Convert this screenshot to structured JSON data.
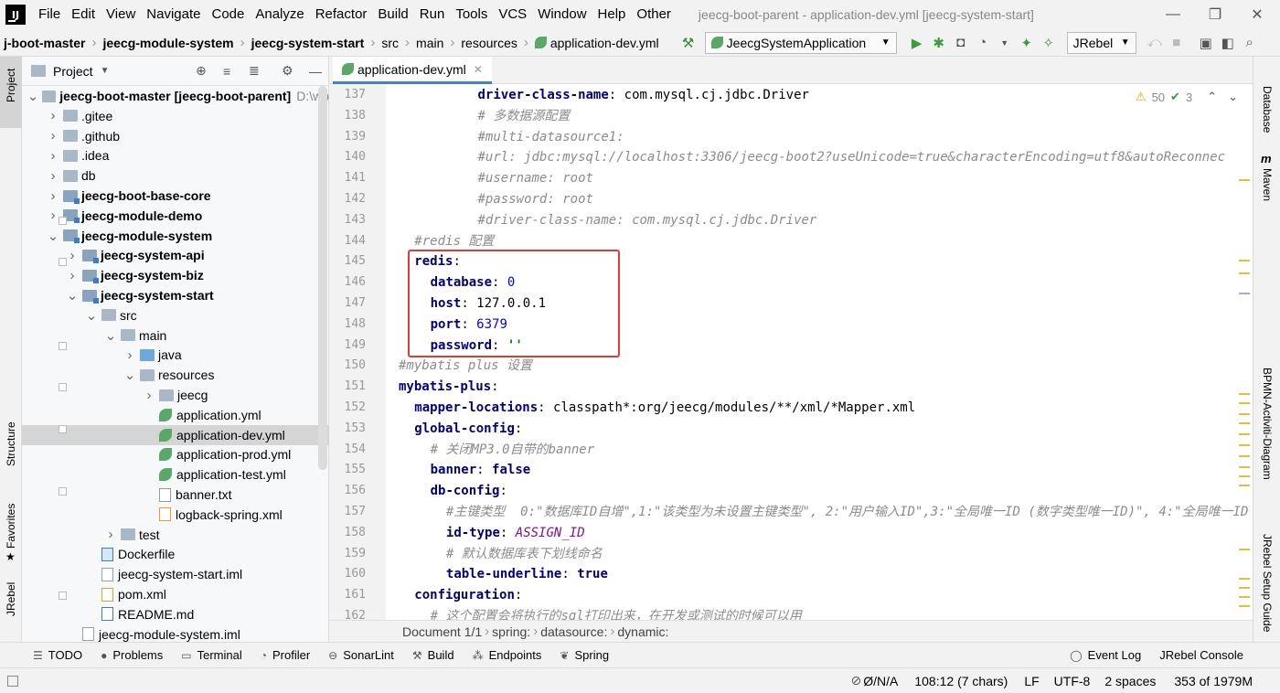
{
  "menu": [
    "File",
    "Edit",
    "View",
    "Navigate",
    "Code",
    "Analyze",
    "Refactor",
    "Build",
    "Run",
    "Tools",
    "VCS",
    "Window",
    "Help",
    "Other"
  ],
  "window_title": "jeecg-boot-parent - application-dev.yml [jeecg-system-start]",
  "nav": {
    "crumbs": [
      "j-boot-master",
      "jeecg-module-system",
      "jeecg-system-start",
      "src",
      "main",
      "resources",
      "application-dev.yml"
    ],
    "run_config": "JeecgSystemApplication",
    "jrebel": "JRebel"
  },
  "strip_left": {
    "project": "Project",
    "structure": "Structure",
    "favorites": "Favorites",
    "jrebel": "JRebel"
  },
  "project": {
    "title": "Project",
    "tree": [
      {
        "label": "jeecg-boot-master",
        "suffix": "[jeecg-boot-parent]",
        "path": "D:\\wo",
        "depth": 0,
        "arrow": "down",
        "icon": "folder",
        "bold": true
      },
      {
        "label": ".gitee",
        "depth": 1,
        "arrow": "right",
        "icon": "folder"
      },
      {
        "label": ".github",
        "depth": 1,
        "arrow": "right",
        "icon": "folder"
      },
      {
        "label": ".idea",
        "depth": 1,
        "arrow": "right",
        "icon": "folder"
      },
      {
        "label": "db",
        "depth": 1,
        "arrow": "right",
        "icon": "folder"
      },
      {
        "label": "jeecg-boot-base-core",
        "depth": 1,
        "arrow": "right",
        "icon": "module",
        "bold": true
      },
      {
        "label": "jeecg-module-demo",
        "depth": 1,
        "arrow": "right",
        "icon": "module",
        "bold": true
      },
      {
        "label": "jeecg-module-system",
        "depth": 1,
        "arrow": "down",
        "icon": "module",
        "bold": true
      },
      {
        "label": "jeecg-system-api",
        "depth": 2,
        "arrow": "right",
        "icon": "module",
        "bold": true
      },
      {
        "label": "jeecg-system-biz",
        "depth": 2,
        "arrow": "right",
        "icon": "module",
        "bold": true
      },
      {
        "label": "jeecg-system-start",
        "depth": 2,
        "arrow": "down",
        "icon": "module",
        "bold": true
      },
      {
        "label": "src",
        "depth": 3,
        "arrow": "down",
        "icon": "folder"
      },
      {
        "label": "main",
        "depth": 4,
        "arrow": "down",
        "icon": "folder"
      },
      {
        "label": "java",
        "depth": 5,
        "arrow": "right",
        "icon": "src"
      },
      {
        "label": "resources",
        "depth": 5,
        "arrow": "down",
        "icon": "res"
      },
      {
        "label": "jeecg",
        "depth": 6,
        "arrow": "right",
        "icon": "folder"
      },
      {
        "label": "application.yml",
        "depth": 6,
        "icon": "yml"
      },
      {
        "label": "application-dev.yml",
        "depth": 6,
        "icon": "yml",
        "selected": true
      },
      {
        "label": "application-prod.yml",
        "depth": 6,
        "icon": "yml"
      },
      {
        "label": "application-test.yml",
        "depth": 6,
        "icon": "yml"
      },
      {
        "label": "banner.txt",
        "depth": 6,
        "icon": "txt"
      },
      {
        "label": "logback-spring.xml",
        "depth": 6,
        "icon": "xml"
      },
      {
        "label": "test",
        "depth": 4,
        "arrow": "right",
        "icon": "folder"
      },
      {
        "label": "Dockerfile",
        "depth": 3,
        "icon": "docker"
      },
      {
        "label": "jeecg-system-start.iml",
        "depth": 3,
        "icon": "iml"
      },
      {
        "label": "pom.xml",
        "depth": 3,
        "icon": "xml"
      },
      {
        "label": "README.md",
        "depth": 3,
        "icon": "md"
      },
      {
        "label": "jeecg-module-system.iml",
        "depth": 2,
        "icon": "iml"
      }
    ]
  },
  "editor": {
    "tab": "application-dev.yml",
    "warnings": "50",
    "checks": "3",
    "lines": [
      {
        "n": "137",
        "i": 5,
        "parts": [
          [
            "k",
            "driver-class-name"
          ],
          [
            "v",
            ": com.mysql.cj.jdbc.Driver"
          ]
        ]
      },
      {
        "n": "138",
        "i": 5,
        "parts": [
          [
            "c",
            "# 多数据源配置"
          ]
        ]
      },
      {
        "n": "139",
        "i": 5,
        "parts": [
          [
            "c",
            "#multi-datasource1:"
          ]
        ]
      },
      {
        "n": "140",
        "i": 5,
        "parts": [
          [
            "c",
            "#url: jdbc:mysql://localhost:3306/jeecg-boot2?useUnicode=true&characterEncoding=utf8&autoReconnec"
          ]
        ]
      },
      {
        "n": "141",
        "i": 5,
        "parts": [
          [
            "c",
            "#username: root"
          ]
        ]
      },
      {
        "n": "142",
        "i": 5,
        "parts": [
          [
            "c",
            "#password: root"
          ]
        ]
      },
      {
        "n": "143",
        "i": 5,
        "parts": [
          [
            "c",
            "#driver-class-name: com.mysql.cj.jdbc.Driver"
          ]
        ]
      },
      {
        "n": "144",
        "i": 1,
        "parts": [
          [
            "c",
            "#redis 配置"
          ]
        ]
      },
      {
        "n": "145",
        "i": 1,
        "parts": [
          [
            "k",
            "redis"
          ],
          [
            "v",
            ":"
          ]
        ]
      },
      {
        "n": "146",
        "i": 2,
        "parts": [
          [
            "k",
            "database"
          ],
          [
            "v",
            ": "
          ],
          [
            "n",
            "0"
          ]
        ]
      },
      {
        "n": "147",
        "i": 2,
        "parts": [
          [
            "k",
            "host"
          ],
          [
            "v",
            ": 127.0.0.1"
          ]
        ]
      },
      {
        "n": "148",
        "i": 2,
        "parts": [
          [
            "k",
            "port"
          ],
          [
            "v",
            ": "
          ],
          [
            "n",
            "6379"
          ]
        ]
      },
      {
        "n": "149",
        "i": 2,
        "parts": [
          [
            "k",
            "password"
          ],
          [
            "v",
            ": "
          ],
          [
            "s",
            "''"
          ]
        ]
      },
      {
        "n": "150",
        "i": 0,
        "parts": [
          [
            "c",
            "#mybatis plus 设置"
          ]
        ]
      },
      {
        "n": "151",
        "i": 0,
        "parts": [
          [
            "k",
            "mybatis-plus"
          ],
          [
            "v",
            ":"
          ]
        ]
      },
      {
        "n": "152",
        "i": 1,
        "parts": [
          [
            "k",
            "mapper-locations"
          ],
          [
            "v",
            ": classpath*:org/jeecg/modules/**/xml/*Mapper.xml"
          ]
        ]
      },
      {
        "n": "153",
        "i": 1,
        "parts": [
          [
            "k",
            "global-config"
          ],
          [
            "v",
            ":"
          ]
        ]
      },
      {
        "n": "154",
        "i": 2,
        "parts": [
          [
            "c",
            "# 关闭MP3.0自带的banner"
          ]
        ]
      },
      {
        "n": "155",
        "i": 2,
        "parts": [
          [
            "k",
            "banner"
          ],
          [
            "v",
            ": "
          ],
          [
            "k",
            "false"
          ]
        ]
      },
      {
        "n": "156",
        "i": 2,
        "parts": [
          [
            "k",
            "db-config"
          ],
          [
            "v",
            ":"
          ]
        ]
      },
      {
        "n": "157",
        "i": 3,
        "parts": [
          [
            "c",
            "#主键类型  0:\"数据库ID自增\",1:\"该类型为未设置主键类型\", 2:\"用户输入ID\",3:\"全局唯一ID (数字类型唯一ID)\", 4:\"全局唯一ID"
          ]
        ]
      },
      {
        "n": "158",
        "i": 3,
        "parts": [
          [
            "k",
            "id-type"
          ],
          [
            "v",
            ": "
          ],
          [
            "e",
            "ASSIGN_ID"
          ]
        ]
      },
      {
        "n": "159",
        "i": 3,
        "parts": [
          [
            "c",
            "# 默认数据库表下划线命名"
          ]
        ]
      },
      {
        "n": "160",
        "i": 3,
        "parts": [
          [
            "k",
            "table-underline"
          ],
          [
            "v",
            ": "
          ],
          [
            "k",
            "true"
          ]
        ]
      },
      {
        "n": "161",
        "i": 1,
        "parts": [
          [
            "k",
            "configuration"
          ],
          [
            "v",
            ":"
          ]
        ]
      },
      {
        "n": "162",
        "i": 2,
        "parts": [
          [
            "c",
            "# 这个配置会将执行的sql打印出来，在开发或测试的时候可以用"
          ]
        ]
      }
    ]
  },
  "breadcrumb": [
    "Document 1/1",
    "spring:",
    "datasource:",
    "dynamic:"
  ],
  "strip_right": {
    "database": "Database",
    "maven": "Maven",
    "bpmn": "BPMN-Activiti-Diagram",
    "jrebel_guide": "JRebel Setup Guide"
  },
  "bottom_tools": [
    "TODO",
    "Problems",
    "Terminal",
    "Profiler",
    "SonarLint",
    "Build",
    "Endpoints",
    "Spring"
  ],
  "bottom_right": [
    "Event Log",
    "JRebel Console"
  ],
  "status": {
    "na": "Ø/N/A",
    "pos": "108:12 (7 chars)",
    "lf": "LF",
    "enc": "UTF-8",
    "indent": "2 spaces",
    "mem": "353 of 1979M"
  }
}
